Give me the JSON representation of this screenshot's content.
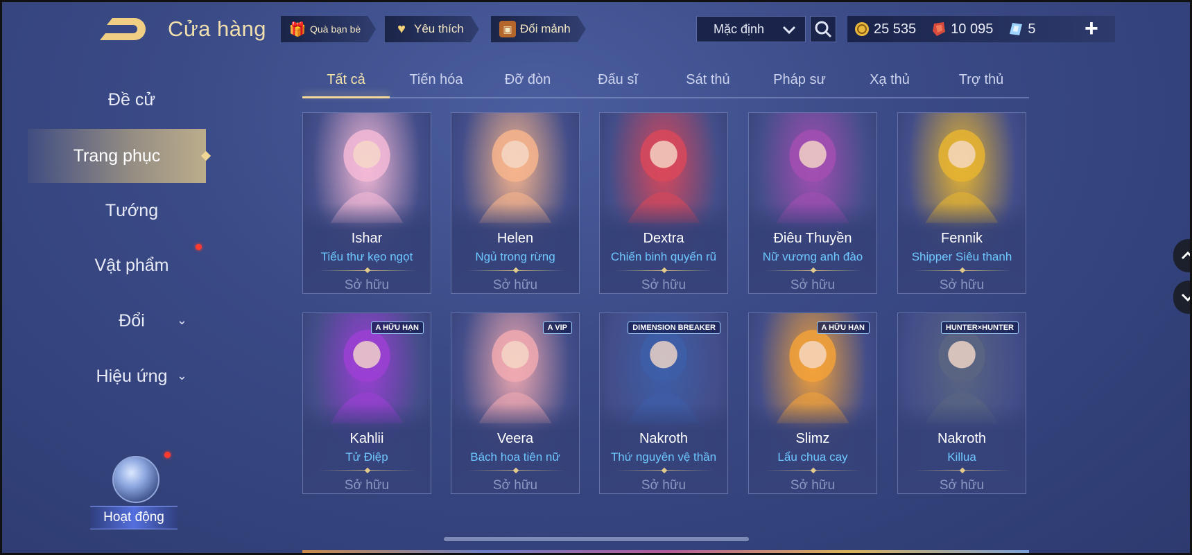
{
  "header": {
    "title": "Cửa hàng",
    "pills": [
      {
        "label": "Quà bạn bè",
        "icon": "gift-icon"
      },
      {
        "label": "Yêu thích",
        "icon": "heart-icon"
      },
      {
        "label": "Đổi mảnh",
        "icon": "fragment-chest-icon"
      }
    ],
    "sort_value": "Mặc định",
    "currency": {
      "gold": "25 535",
      "voucher": "10 095",
      "gem": "5"
    }
  },
  "sidebar": {
    "items": [
      {
        "label": "Đề cử"
      },
      {
        "label": "Trang phục"
      },
      {
        "label": "Tướng"
      },
      {
        "label": "Vật phẩm"
      },
      {
        "label": "Đổi"
      },
      {
        "label": "Hiệu ứng"
      }
    ],
    "activity_label": "Hoạt động"
  },
  "tabs": [
    {
      "label": "Tất cả"
    },
    {
      "label": "Tiến hóa"
    },
    {
      "label": "Đỡ đòn"
    },
    {
      "label": "Đấu sĩ"
    },
    {
      "label": "Sát thủ"
    },
    {
      "label": "Pháp sư"
    },
    {
      "label": "Xạ thủ"
    },
    {
      "label": "Trợ thủ"
    }
  ],
  "cards": [
    {
      "hero": "Ishar",
      "skin": "Tiểu thư kẹo ngọt",
      "status": "Sở hữu",
      "accent": "#f3b9d6",
      "badge": ""
    },
    {
      "hero": "Helen",
      "skin": "Ngủ trong rừng",
      "status": "Sở hữu",
      "accent": "#f6b48c",
      "badge": ""
    },
    {
      "hero": "Dextra",
      "skin": "Chiến binh quyến rũ",
      "status": "Sở hữu",
      "accent": "#d8485a",
      "badge": ""
    },
    {
      "hero": "Điêu Thuyền",
      "skin": "Nữ vương anh đào",
      "status": "Sở hữu",
      "accent": "#a24fb2",
      "badge": ""
    },
    {
      "hero": "Fennik",
      "skin": "Shipper Siêu thanh",
      "status": "Sở hữu",
      "accent": "#e6b431",
      "badge": ""
    },
    {
      "hero": "Kahlii",
      "skin": "Tử Điệp",
      "status": "Sở hữu",
      "accent": "#9b3fd4",
      "badge": "A HỮU HẠN"
    },
    {
      "hero": "Veera",
      "skin": "Bách hoa tiên nữ",
      "status": "Sở hữu",
      "accent": "#f0a9b0",
      "badge": "A VIP"
    },
    {
      "hero": "Nakroth",
      "skin": "Thứ nguyên vệ thần",
      "status": "Sở hữu",
      "accent": "#3d5ea8",
      "badge": "DIMENSION BREAKER"
    },
    {
      "hero": "Slimz",
      "skin": "Lẩu chua cay",
      "status": "Sở hữu",
      "accent": "#f2a13a",
      "badge": "A HỮU HẠN"
    },
    {
      "hero": "Nakroth",
      "skin": "Killua",
      "status": "Sở hữu",
      "accent": "#5a6582",
      "badge": "HUNTER×HUNTER"
    }
  ]
}
